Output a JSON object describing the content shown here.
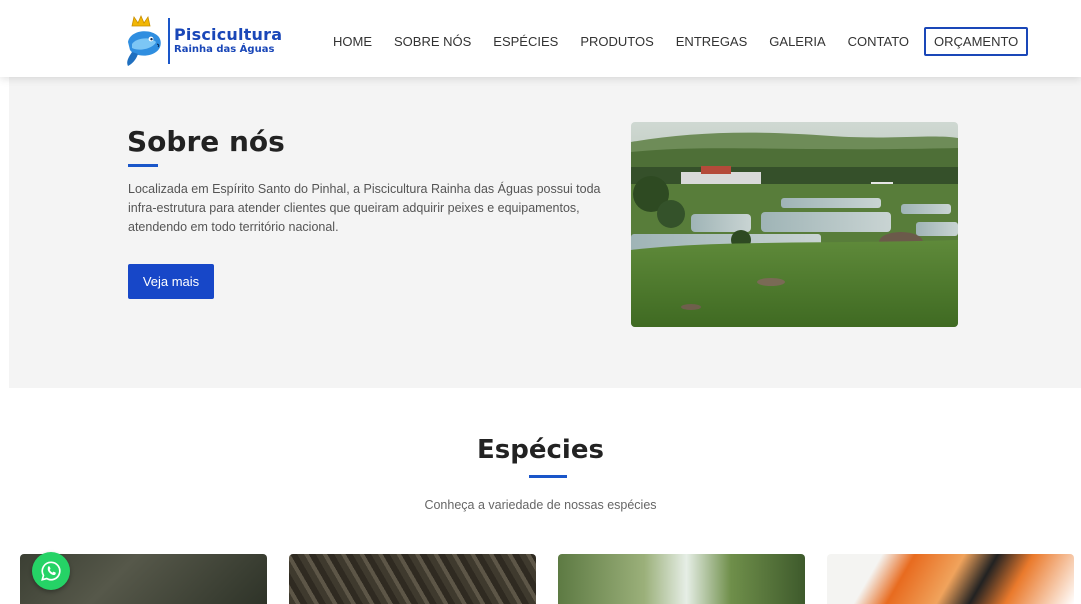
{
  "header": {
    "logo_title": "Piscicultura",
    "logo_subtitle": "Rainha das Águas",
    "nav": [
      {
        "label": "HOME"
      },
      {
        "label": "SOBRE NÓS"
      },
      {
        "label": "ESPÉCIES"
      },
      {
        "label": "PRODUTOS"
      },
      {
        "label": "ENTREGAS"
      },
      {
        "label": "GALERIA"
      },
      {
        "label": "CONTATO"
      }
    ],
    "cta_label": "ORÇAMENTO"
  },
  "about": {
    "title": "Sobre nós",
    "text": "Localizada em Espírito Santo do Pinhal, a Piscicultura Rainha das Águas possui toda infra-estrutura para atender clientes que queiram adquirir peixes e equipamentos, atendendo em todo território nacional.",
    "button_label": "Veja mais"
  },
  "species": {
    "title": "Espécies",
    "subtitle": "Conheça a variedade de nossas espécies"
  },
  "colors": {
    "brand_blue": "#1a47b8",
    "button_blue": "#1747c8",
    "whatsapp_green": "#25d366"
  },
  "icons": {
    "whatsapp": "whatsapp-icon",
    "logo": "fish-crown-logo-icon"
  }
}
